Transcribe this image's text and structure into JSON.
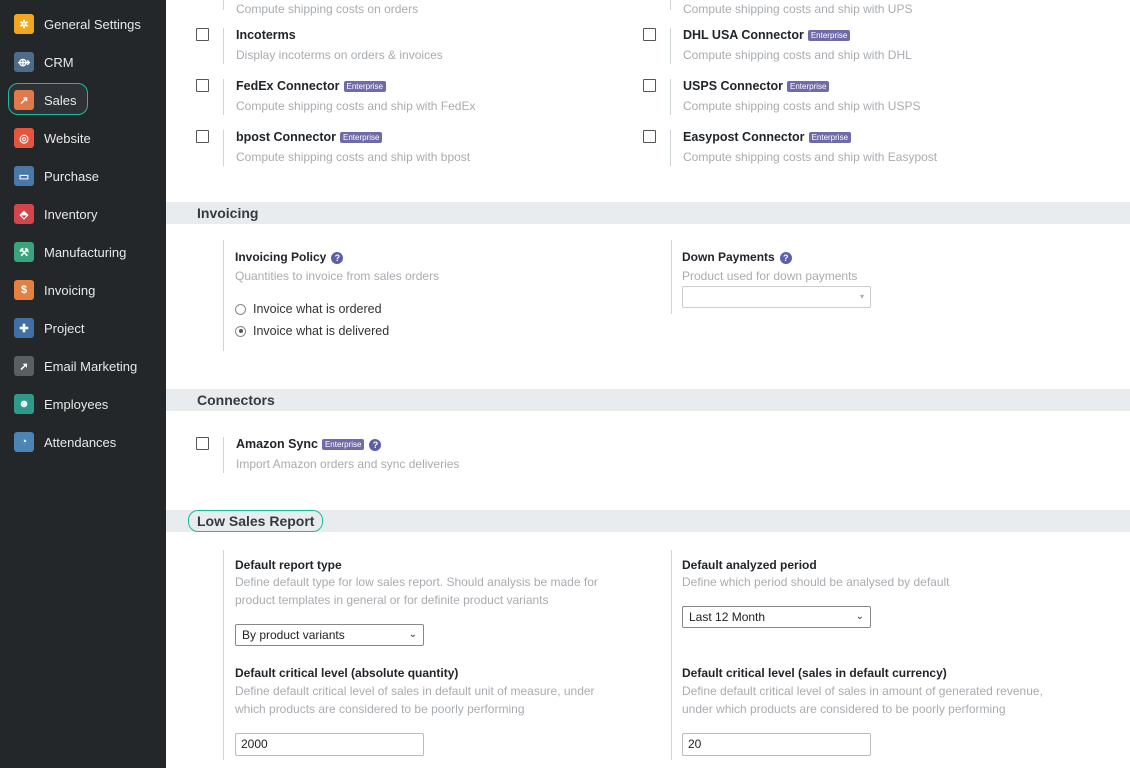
{
  "sidebar": {
    "items": [
      {
        "label": "General Settings",
        "icon": "gear-icon",
        "color": "#f0a820"
      },
      {
        "label": "CRM",
        "icon": "handshake-icon",
        "color": "#4d6c8a"
      },
      {
        "label": "Sales",
        "icon": "chart-line-icon",
        "color": "#e07a4b"
      },
      {
        "label": "Website",
        "icon": "globe-icon",
        "color": "#e5553e"
      },
      {
        "label": "Purchase",
        "icon": "credit-card-icon",
        "color": "#4a78a8"
      },
      {
        "label": "Inventory",
        "icon": "box-icon",
        "color": "#d2464b"
      },
      {
        "label": "Manufacturing",
        "icon": "wrench-icon",
        "color": "#38a37d"
      },
      {
        "label": "Invoicing",
        "icon": "invoice-icon",
        "color": "#e38240"
      },
      {
        "label": "Project",
        "icon": "puzzle-icon",
        "color": "#3f6fa3"
      },
      {
        "label": "Email Marketing",
        "icon": "paper-plane-icon",
        "color": "#5a5f62"
      },
      {
        "label": "Employees",
        "icon": "users-icon",
        "color": "#2f9a8c"
      },
      {
        "label": "Attendances",
        "icon": "user-clock-icon",
        "color": "#4c84b6"
      }
    ],
    "active": "Sales"
  },
  "shipping": {
    "cut_left_desc": "Compute shipping costs on orders",
    "cut_right_desc": "Compute shipping costs and ship with UPS",
    "settings": [
      {
        "title": "Incoterms",
        "desc": "Display incoterms on orders & invoices",
        "badge": ""
      },
      {
        "title": "DHL USA Connector",
        "desc": "Compute shipping costs and ship with DHL",
        "badge": "Enterprise"
      },
      {
        "title": "FedEx Connector",
        "desc": "Compute shipping costs and ship with FedEx",
        "badge": "Enterprise"
      },
      {
        "title": "USPS Connector",
        "desc": "Compute shipping costs and ship with USPS",
        "badge": "Enterprise"
      },
      {
        "title": "bpost Connector",
        "desc": "Compute shipping costs and ship with bpost",
        "badge": "Enterprise"
      },
      {
        "title": "Easypost Connector",
        "desc": "Compute shipping costs and ship with Easypost",
        "badge": "Enterprise"
      }
    ]
  },
  "invoicing": {
    "header": "Invoicing",
    "policy_title": "Invoicing Policy",
    "policy_desc": "Quantities to invoice from sales orders",
    "radio_ordered": "Invoice what is ordered",
    "radio_delivered": "Invoice what is delivered",
    "selected": "delivered",
    "down_title": "Down Payments",
    "down_desc": "Product used for down payments",
    "down_value": ""
  },
  "connectors": {
    "header": "Connectors",
    "amazon_title": "Amazon Sync",
    "amazon_badge": "Enterprise",
    "amazon_desc": "Import Amazon orders and sync deliveries"
  },
  "low_sales": {
    "header": "Low Sales Report",
    "report_type_title": "Default report type",
    "report_type_desc1": "Define default type for low sales report. Should analysis be made for",
    "report_type_desc2": "product templates in general or for definite product variants",
    "report_type_value": "By product variants",
    "period_title": "Default analyzed period",
    "period_desc": "Define which period should be analysed by default",
    "period_value": "Last 12 Month",
    "crit_qty_title": "Default critical level (absolute quantity)",
    "crit_qty_desc1": "Define default critical level of sales in default unit of measure, under",
    "crit_qty_desc2": "which products are considered to be poorly performing",
    "crit_qty_value": "2000",
    "crit_cur_title": "Default critical level (sales in default currency)",
    "crit_cur_desc1": "Define default critical level of sales in amount of generated revenue,",
    "crit_cur_desc2": "under which products are considered to be poorly performing",
    "crit_cur_value": "20"
  },
  "help_glyph": "?",
  "caret_glyph": "⌄"
}
